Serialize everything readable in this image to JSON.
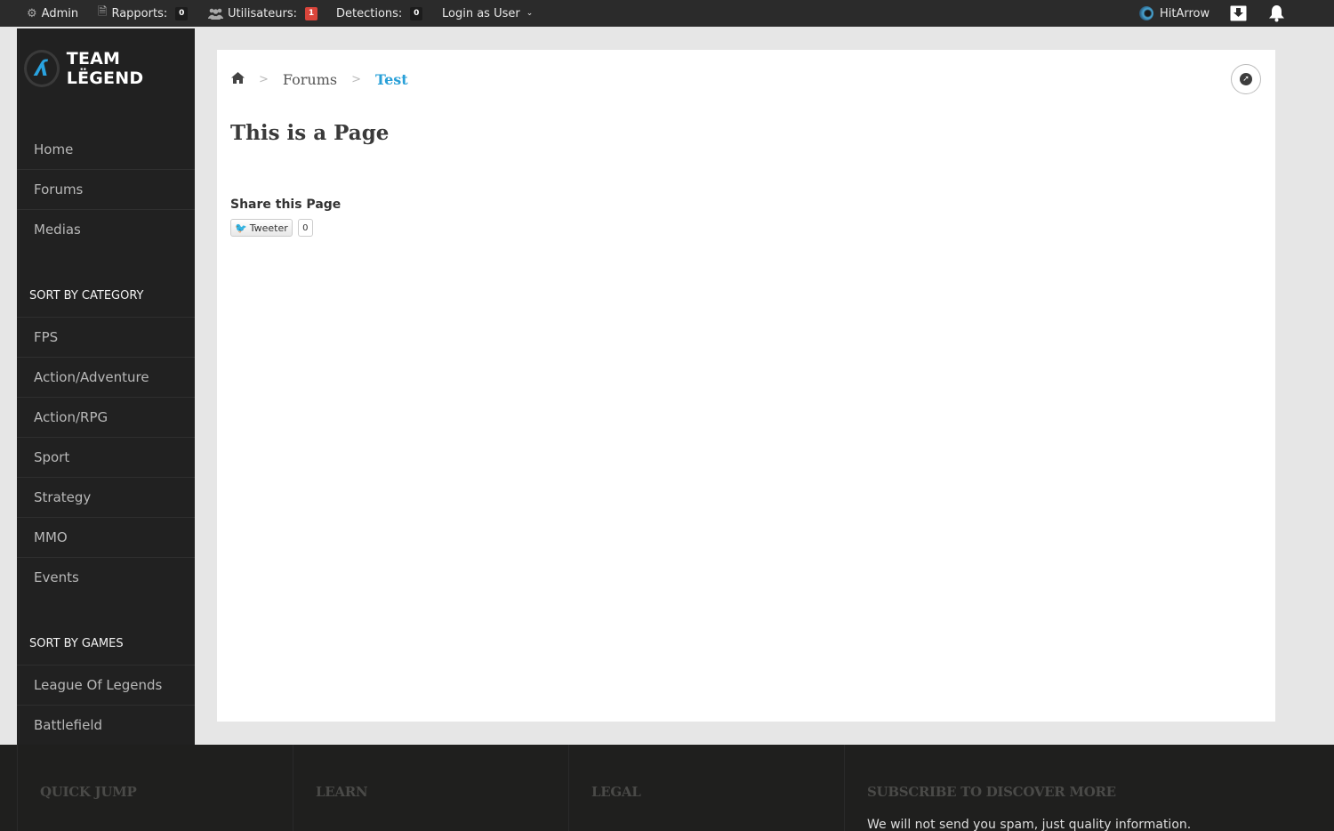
{
  "adminbar": {
    "admin_label": "Admin",
    "reports_label": "Rapports:",
    "reports_count": "0",
    "users_label": "Utilisateurs:",
    "users_count": "1",
    "detections_label": "Detections:",
    "detections_count": "0",
    "login_as_label": "Login as User",
    "username": "HitArrow",
    "icons": {
      "admin": "gear-icon",
      "reports": "document-icon",
      "users": "users-icon",
      "login_as": "chevron-down-icon",
      "user_avatar": "avatar",
      "inbox": "inbox-download-icon",
      "alerts": "bell-icon"
    }
  },
  "sidebar": {
    "logo_text": "TEAM LËGEND",
    "main_nav": [
      {
        "label": "Home"
      },
      {
        "label": "Forums"
      },
      {
        "label": "Medias"
      }
    ],
    "category_heading": "SORT BY CATEGORY",
    "categories": [
      {
        "label": "FPS"
      },
      {
        "label": "Action/Adventure"
      },
      {
        "label": "Action/RPG"
      },
      {
        "label": "Sport"
      },
      {
        "label": "Strategy"
      },
      {
        "label": "MMO"
      },
      {
        "label": "Events"
      }
    ],
    "games_heading": "SORT BY GAMES",
    "games": [
      {
        "label": "League Of Legends"
      },
      {
        "label": "Battlefield"
      }
    ]
  },
  "breadcrumb": {
    "home_icon": "home-icon",
    "items": [
      "Forums",
      "Test"
    ]
  },
  "page": {
    "title": "This is a Page",
    "share_title": "Share this Page",
    "tweet_label": "Tweeter",
    "tweet_count": "0"
  },
  "footer": {
    "columns": [
      {
        "heading": "QUICK JUMP"
      },
      {
        "heading": "LEARN"
      },
      {
        "heading": "LEGAL"
      },
      {
        "heading": "SUBSCRIBE TO DISCOVER MORE",
        "text": "We will not send you spam, just quality information."
      }
    ]
  },
  "colors": {
    "accent": "#29a0d8",
    "adminbar_bg": "#2b2b2b",
    "sidebar_bg": "#212121",
    "footer_bg": "#1f1f1e",
    "badge_alert": "#d9453b"
  }
}
